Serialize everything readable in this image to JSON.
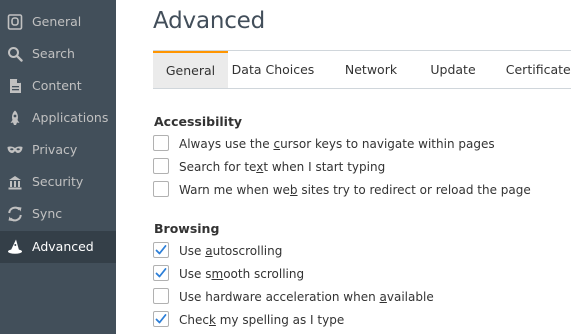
{
  "sidebar": {
    "items": [
      {
        "label": "General",
        "icon": "general-icon",
        "active": false
      },
      {
        "label": "Search",
        "icon": "search-icon",
        "active": false
      },
      {
        "label": "Content",
        "icon": "content-icon",
        "active": false
      },
      {
        "label": "Applications",
        "icon": "applications-icon",
        "active": false
      },
      {
        "label": "Privacy",
        "icon": "privacy-mask-icon",
        "active": false
      },
      {
        "label": "Security",
        "icon": "security-icon",
        "active": false
      },
      {
        "label": "Sync",
        "icon": "sync-icon",
        "active": false
      },
      {
        "label": "Advanced",
        "icon": "advanced-wizard-hat-icon",
        "active": true
      }
    ]
  },
  "page": {
    "title": "Advanced"
  },
  "tabs": [
    {
      "label": "General",
      "active": true
    },
    {
      "label": "Data Choices",
      "active": false
    },
    {
      "label": "Network",
      "active": false
    },
    {
      "label": "Update",
      "active": false
    },
    {
      "label": "Certificates",
      "active": false
    }
  ],
  "sections": [
    {
      "heading": "Accessibility",
      "options": [
        {
          "pre": "Always use the ",
          "access": "c",
          "post": "ursor keys to navigate within pages",
          "checked": false
        },
        {
          "pre": "Search for te",
          "access": "x",
          "post": "t when I start typing",
          "checked": false
        },
        {
          "pre": "Warn me when we",
          "access": "b",
          "post": " sites try to redirect or reload the page",
          "checked": false
        }
      ]
    },
    {
      "heading": "Browsing",
      "options": [
        {
          "pre": "Use ",
          "access": "a",
          "post": "utoscrolling",
          "checked": true
        },
        {
          "pre": "Use s",
          "access": "m",
          "post": "ooth scrolling",
          "checked": true
        },
        {
          "pre": "Use hardware acceleration when ",
          "access": "a",
          "post": "vailable",
          "checked": false
        },
        {
          "pre": "Chec",
          "access": "k",
          "post": " my spelling as I type",
          "checked": true
        }
      ]
    }
  ],
  "colors": {
    "sidebar_bg": "#424f5a",
    "sidebar_active_bg": "#343f48",
    "tab_accent": "#ff9500",
    "check_color": "#2d7fd8"
  }
}
